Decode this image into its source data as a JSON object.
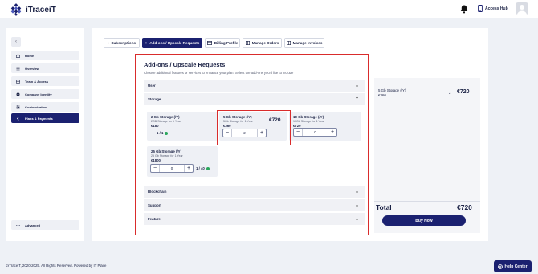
{
  "app": {
    "brand": "iTraceiT",
    "access_hub": "Access Hub"
  },
  "sidebar": {
    "items": [
      {
        "label": "Home",
        "icon": "home-icon"
      },
      {
        "label": "Overview",
        "icon": "list-icon"
      },
      {
        "label": "Team & Access",
        "icon": "team-icon"
      },
      {
        "label": "Company Identity",
        "icon": "identity-icon"
      },
      {
        "label": "Customization",
        "icon": "customization-icon"
      },
      {
        "label": "Plans & Payments",
        "icon": "chevron-left-icon",
        "active": true
      }
    ],
    "advanced": "Advanced"
  },
  "tabs": [
    {
      "label": "Subscriptions",
      "icon": "chevron-left-icon"
    },
    {
      "label": "Add-ons / Upscale Requests",
      "icon": "plus-icon",
      "active": true
    },
    {
      "label": "Billing Profile",
      "icon": "card-icon"
    },
    {
      "label": "Manage Orders",
      "icon": "grid-icon"
    },
    {
      "label": "Manage Invoices",
      "icon": "grid-icon"
    }
  ],
  "addons": {
    "title": "Add-ons / Upscale Requests",
    "description": "Choose additional features or services to enhance your plan. Select the add-ons you'd like to include",
    "sections": {
      "user": "User",
      "storage": "Storage",
      "blockchain": "Blockchain",
      "support": "Support",
      "feature": "Feature"
    },
    "storage_items": [
      {
        "name": "2 Gb Storage (/Y)",
        "desc": "2GB Storage for 1 Year",
        "price": "€180",
        "count": "1 / 1"
      },
      {
        "name": "5 Gb Storage (/Y)",
        "desc": "5Gb Storage for 1 Year",
        "price": "€360",
        "total": "€720",
        "qty": "2"
      },
      {
        "name": "10 Gb Storage (/Y)",
        "desc": "10Gb Storage for 1 Year",
        "price": "€720",
        "qty": "0"
      },
      {
        "name": "25 Gb Storage (/Y)",
        "desc": "25 Gb Storage for 1 Year",
        "price": "€1800",
        "qty": "0",
        "count": "1 / 40"
      }
    ]
  },
  "summary": {
    "item_name": "5 Gb Storage (/Y)",
    "item_price": "€360",
    "item_qty": "2",
    "item_total": "€720",
    "total_label": "Total",
    "total_value": "€720",
    "buy_label": "Buy Now"
  },
  "footer": {
    "copyright": "©iTraceiT, 2020-2025. All Rights Reserved. Powered by IT Place"
  },
  "help": {
    "label": "Help Center"
  },
  "colors": {
    "primary": "#1b2170",
    "highlight": "#d92c2c",
    "success": "#2aa75c"
  }
}
